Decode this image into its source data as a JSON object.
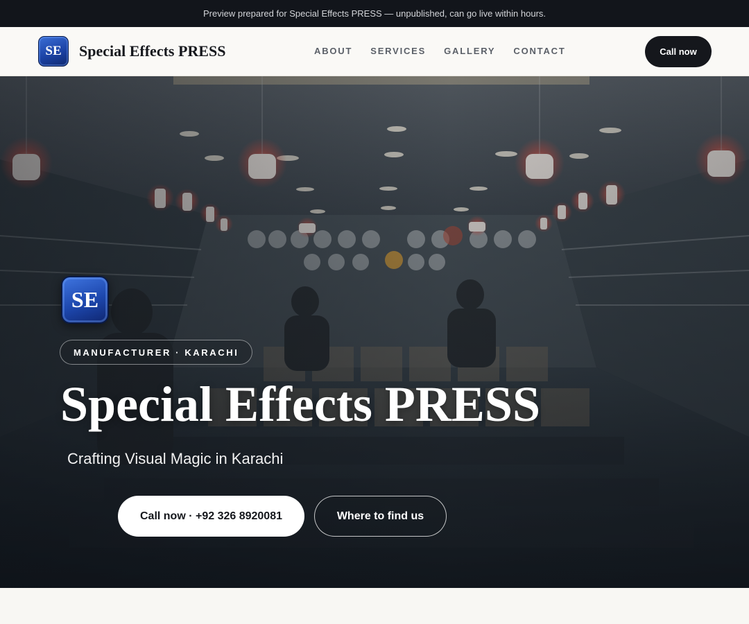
{
  "announcement": {
    "text": "Preview prepared for Special Effects PRESS — unpublished, can go live within hours."
  },
  "header": {
    "logo_text": "SE",
    "brand_name": "Special Effects PRESS",
    "nav": [
      "ABOUT",
      "SERVICES",
      "GALLERY",
      "CONTACT"
    ],
    "call_label": "Call now"
  },
  "hero": {
    "logo_text": "SE",
    "badge": "MANUFACTURER · KARACHI",
    "title": "Special Effects PRESS",
    "subtitle": "Crafting Visual Magic in Karachi",
    "primary_cta": "Call now · +92 326 8920081",
    "secondary_cta": "Where to find us"
  },
  "colors": {
    "dark": "#12151b",
    "brand_blue": "#1d47ad",
    "page_bg": "#f8f7f3"
  }
}
